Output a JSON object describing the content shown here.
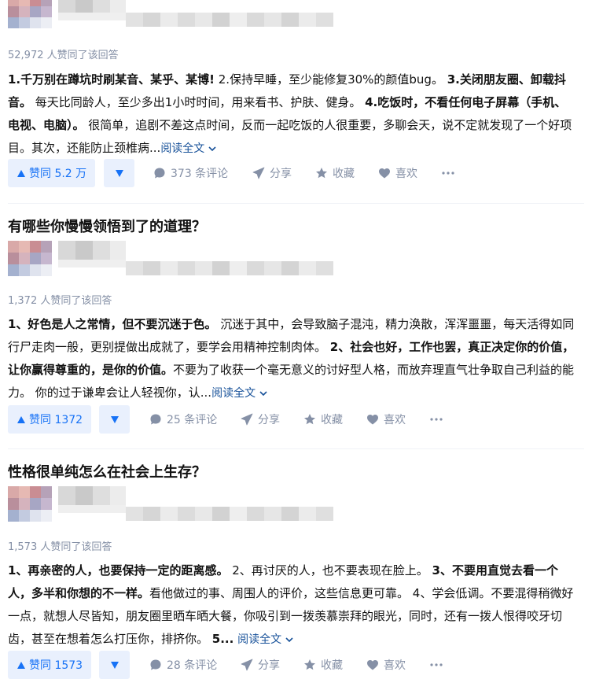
{
  "cards": [
    {
      "question": "",
      "agree_text": "52,972 人赞同了该回答",
      "excerpt": {
        "p1": "1.千万别在蹲坑时刷某音、某乎、某博!",
        "p2": " 2.保持早睡，至少能修复30%的颜值bug。 ",
        "p3": "3.关闭朋友圈、卸载抖音。",
        "p4": " 每天比同龄人，至少多出1小时时间，用来看书、护肤、健身。 ",
        "p5": "4.吃饭时，不看任何电子屏幕（手机、电视、电脑）。",
        "p6": " 很简单，追剧不差这点时间，反而一起吃饭的人很重要，多聊会天，说不定就发现了一个好项目。其次，还能防止颈椎病..."
      },
      "read_more": "阅读全文",
      "vote_label": "赞同 5.2 万",
      "comments": "373 条评论",
      "share": "分享",
      "collect": "收藏",
      "like": "喜欢"
    },
    {
      "question": "有哪些你慢慢领悟到了的道理？",
      "agree_text": "1,372 人赞同了该回答",
      "excerpt": {
        "p1": "1、好色是人之常情，但不要沉迷于色。",
        "p2": " 沉迷于其中，会导致脑子混沌，精力涣散，浑浑噩噩，每天活得如同行尸走肉一般，更别提做出成就了，要学会用精神控制肉体。 ",
        "p3": "2、社会也好，工作也罢，真正决定你的价值，让你赢得尊重的，是你的价值。",
        "p4": "不要为了收获一个毫无意义的讨好型人格，而放弃理直气壮争取自己利益的能力。 你的过于谦卑会让人轻视你，认..."
      },
      "read_more": "阅读全文",
      "vote_label": "赞同 1372",
      "comments": "25 条评论",
      "share": "分享",
      "collect": "收藏",
      "like": "喜欢"
    },
    {
      "question": "性格很单纯怎么在社会上生存？",
      "agree_text": "1,573 人赞同了该回答",
      "excerpt": {
        "p1": "1、再亲密的人，也要保持一定的距离感。",
        "p2": " 2、再讨厌的人，也不要表现在脸上。 ",
        "p3": "3、不要用直觉去看一个人，多半和你想的不一样。",
        "p4": "看他做过的事、周围人的评价，这些信息更可靠。 4、学会低调。不要混得稍微好一点，就想人尽皆知，朋友圈里晒车晒大餐，你吸引到一拨羡慕崇拜的眼光，同时，还有一拨人恨得咬牙切齿，甚至在想着怎么打压你，排挤你。 ",
        "p5": "5..."
      },
      "read_more": "阅读全文",
      "vote_label": "赞同 1573",
      "comments": "28 条评论",
      "share": "分享",
      "collect": "收藏",
      "like": "喜欢"
    }
  ],
  "icons": {
    "vote_up": "triangle-up-icon",
    "vote_down": "triangle-down-icon",
    "comment": "speech-bubble-icon",
    "share": "paper-plane-icon",
    "collect": "star-icon",
    "like": "heart-icon",
    "more": "ellipsis-icon",
    "read_more": "chevron-down-icon"
  },
  "colors": {
    "accent": "#1772f6",
    "vote_bg": "#e9f0fd",
    "muted": "#8590a6",
    "link": "#175199",
    "text": "#121212"
  }
}
